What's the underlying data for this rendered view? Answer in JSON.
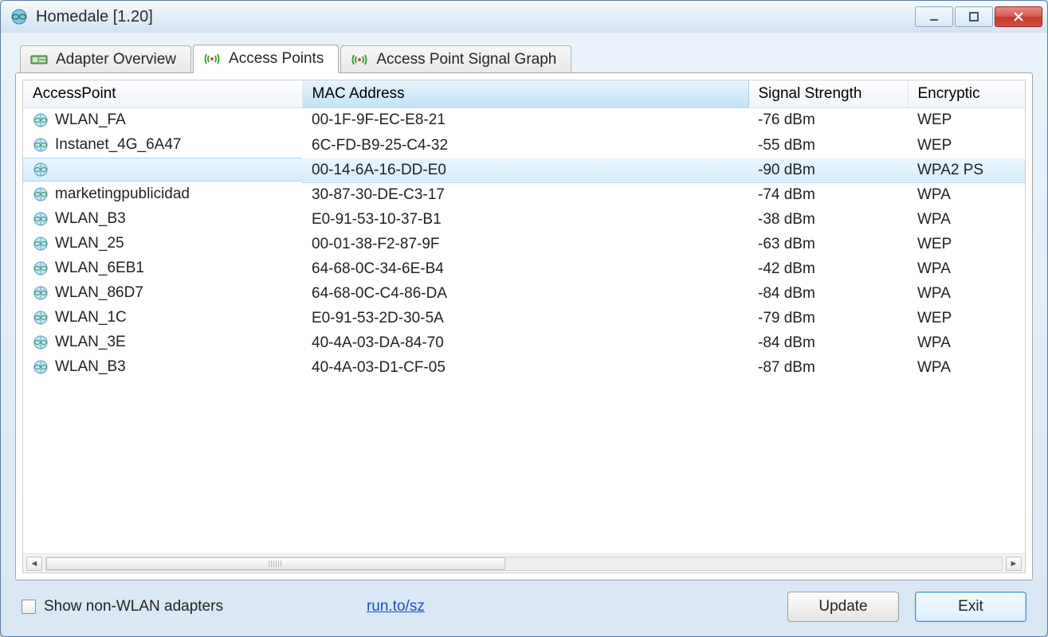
{
  "window": {
    "title": "Homedale [1.20]"
  },
  "tabs": [
    {
      "label": "Adapter Overview",
      "icon": "adapter-icon"
    },
    {
      "label": "Access Points",
      "icon": "antenna-icon"
    },
    {
      "label": "Access Point Signal Graph",
      "icon": "antenna-icon"
    }
  ],
  "active_tab_index": 1,
  "columns": {
    "access_point": "AccessPoint",
    "mac": "MAC Address",
    "signal": "Signal Strength",
    "encryption": "Encryptic"
  },
  "sorted_column": "mac",
  "rows": [
    {
      "ap": "WLAN_FA",
      "mac": "00-1F-9F-EC-E8-21",
      "signal": "-76 dBm",
      "enc": "WEP",
      "selected": false
    },
    {
      "ap": "Instanet_4G_6A47",
      "mac": "6C-FD-B9-25-C4-32",
      "signal": "-55 dBm",
      "enc": "WEP",
      "selected": false
    },
    {
      "ap": "",
      "mac": "00-14-6A-16-DD-E0",
      "signal": "-90 dBm",
      "enc": "WPA2 PS",
      "selected": true
    },
    {
      "ap": "marketingpublicidad",
      "mac": "30-87-30-DE-C3-17",
      "signal": "-74 dBm",
      "enc": "WPA",
      "selected": false
    },
    {
      "ap": "WLAN_B3",
      "mac": "E0-91-53-10-37-B1",
      "signal": "-38 dBm",
      "enc": "WPA",
      "selected": false
    },
    {
      "ap": "WLAN_25",
      "mac": "00-01-38-F2-87-9F",
      "signal": "-63 dBm",
      "enc": "WEP",
      "selected": false
    },
    {
      "ap": "WLAN_6EB1",
      "mac": "64-68-0C-34-6E-B4",
      "signal": "-42 dBm",
      "enc": "WPA",
      "selected": false
    },
    {
      "ap": "WLAN_86D7",
      "mac": "64-68-0C-C4-86-DA",
      "signal": "-84 dBm",
      "enc": "WPA",
      "selected": false
    },
    {
      "ap": "WLAN_1C",
      "mac": "E0-91-53-2D-30-5A",
      "signal": "-79 dBm",
      "enc": "WEP",
      "selected": false
    },
    {
      "ap": "WLAN_3E",
      "mac": "40-4A-03-DA-84-70",
      "signal": "-84 dBm",
      "enc": "WPA",
      "selected": false
    },
    {
      "ap": "WLAN_B3",
      "mac": "40-4A-03-D1-CF-05",
      "signal": "-87 dBm",
      "enc": "WPA",
      "selected": false
    }
  ],
  "footer": {
    "checkbox_label": "Show non-WLAN adapters",
    "checkbox_checked": false,
    "link_text": "run.to/sz",
    "update_label": "Update",
    "exit_label": "Exit"
  }
}
